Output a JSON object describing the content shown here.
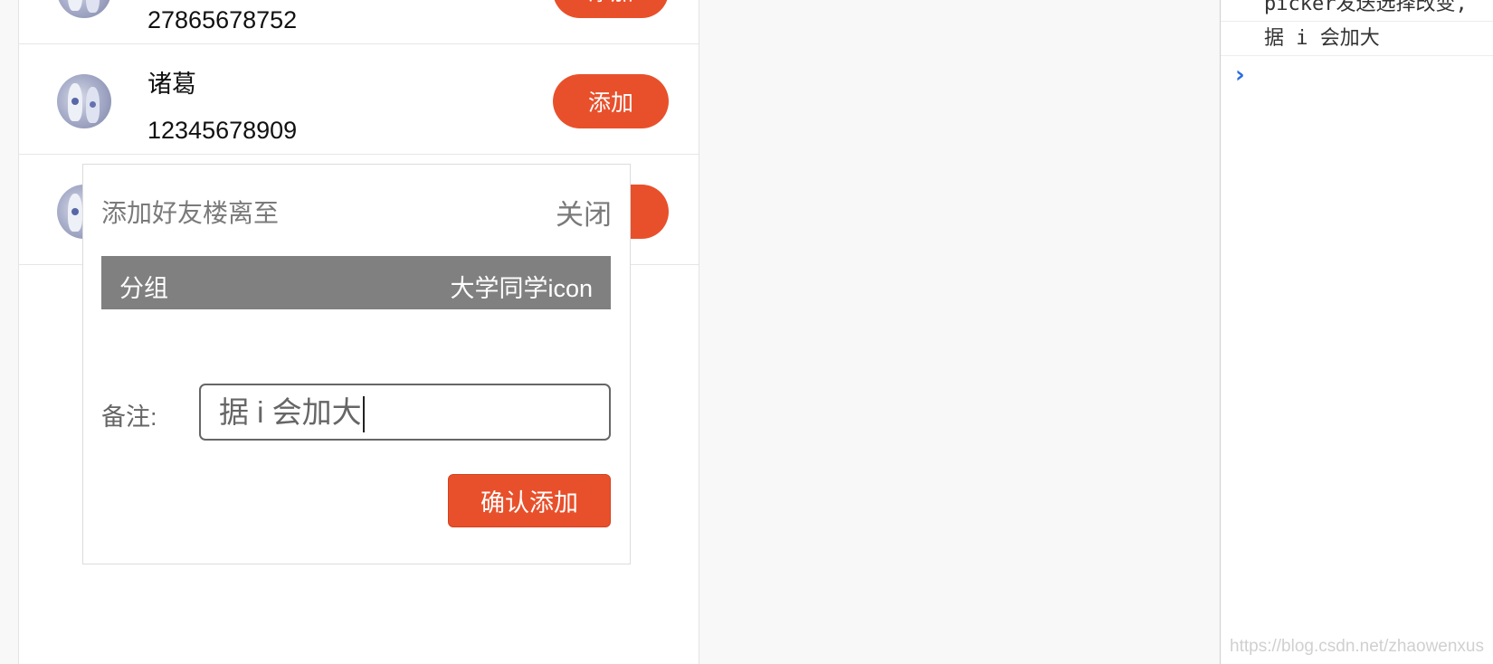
{
  "contacts": [
    {
      "name": "",
      "phone": "27865678752",
      "button": "添加"
    },
    {
      "name": "诸葛",
      "phone": "12345678909",
      "button": "添加"
    },
    {
      "name": "",
      "phone": "",
      "button": ""
    }
  ],
  "dialog": {
    "title": "添加好友楼离至",
    "close_label": "关闭",
    "group_label": "分组",
    "group_value": "大学同学icon",
    "remark_label": "备注:",
    "remark_value": "据 i 会加大",
    "confirm_label": "确认添加"
  },
  "console": {
    "lines": [
      "picker发送选择改变,",
      "据 i 会加大"
    ],
    "prompt": "›"
  },
  "watermark": "https://blog.csdn.net/zhaowenxus",
  "colors": {
    "accent": "#e8502b",
    "group_bar": "#808080",
    "prompt": "#2b6ee0"
  }
}
